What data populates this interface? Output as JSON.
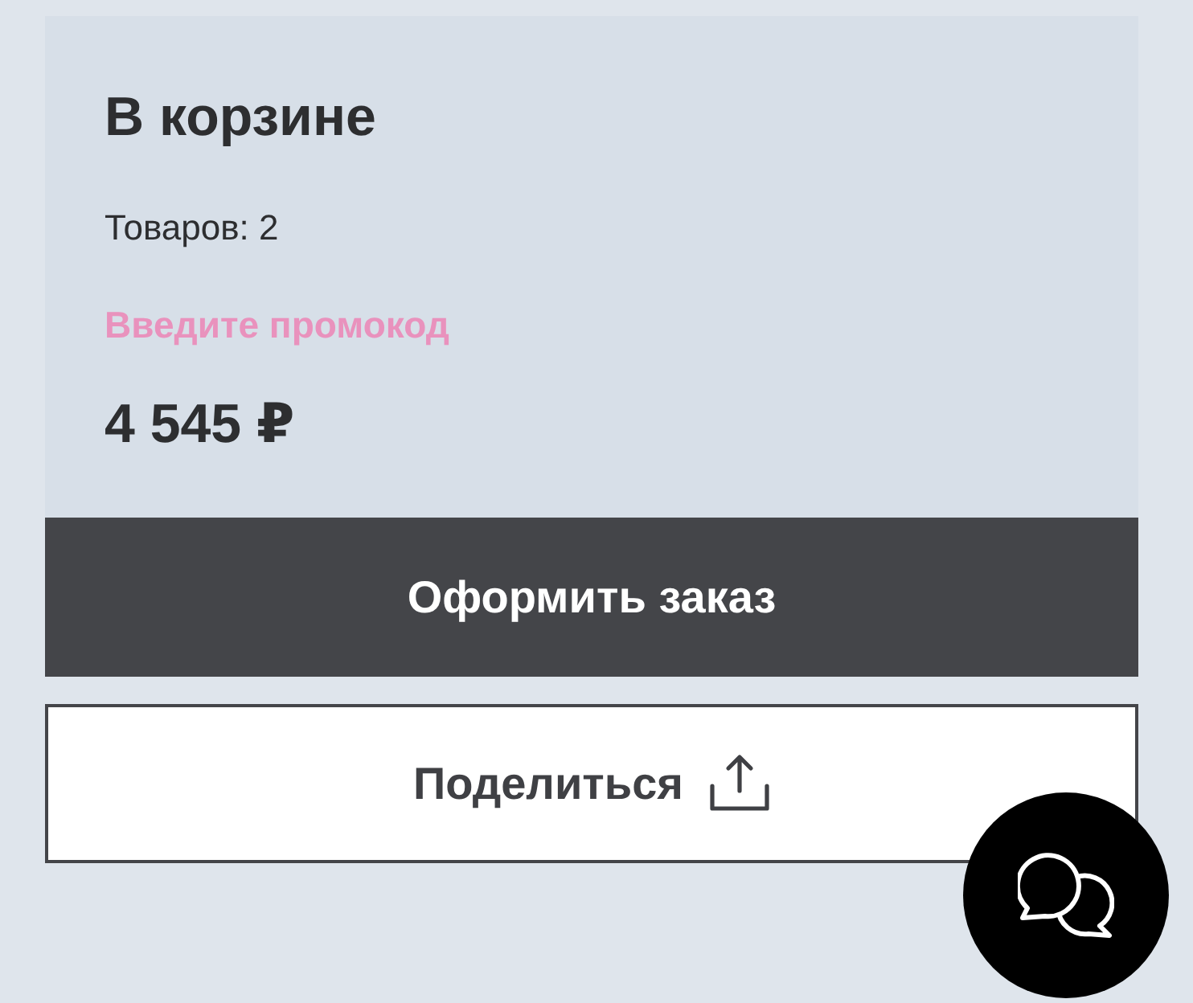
{
  "cart": {
    "title": "В корзине",
    "items_count": "Товаров: 2",
    "promo_link": "Введите промокод",
    "total": "4 545 ₽"
  },
  "actions": [
    {
      "kind": "primary",
      "label": "Оформить заказ"
    },
    {
      "kind": "share",
      "label": "Поделиться"
    }
  ]
}
